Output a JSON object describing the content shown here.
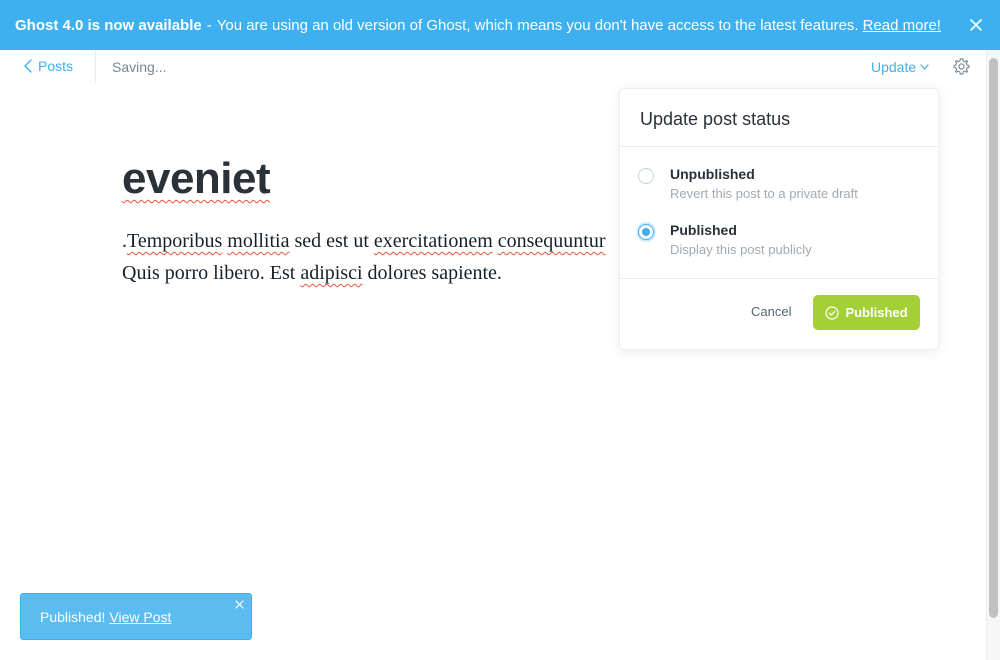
{
  "banner": {
    "headline": "Ghost 4.0 is now available",
    "separator": "-",
    "message": "You are using an old version of Ghost, which means you don't have access to the latest features.",
    "link": "Read more!",
    "close_icon": "close-icon"
  },
  "header": {
    "back_label": "Posts",
    "status": "Saving...",
    "update_label": "Update",
    "settings_icon": "gear-icon"
  },
  "post": {
    "title": "eveniet",
    "body": {
      "line1": {
        "w1": ".",
        "w2": "Temporibus",
        "w3": " ",
        "w4": "mollitia",
        "w5": " sed est ut ",
        "w6": "exercitationem",
        "w7": " ",
        "w8": "consequuntur"
      },
      "line2": {
        "w1": "Quis porro libero. Est ",
        "w2": "adipisci",
        "w3": " dolores sapiente."
      }
    }
  },
  "dropdown": {
    "title": "Update post status",
    "options": [
      {
        "label": "Unpublished",
        "description": "Revert this post to a private draft",
        "selected": false
      },
      {
        "label": "Published",
        "description": "Display this post publicly",
        "selected": true
      }
    ],
    "cancel_label": "Cancel",
    "confirm_label": "Published"
  },
  "toast": {
    "message": "Published!",
    "link": "View Post"
  },
  "colors": {
    "accent": "#3eb0ef",
    "publish_green": "#a4d037",
    "spellcheck": "#e25440"
  }
}
